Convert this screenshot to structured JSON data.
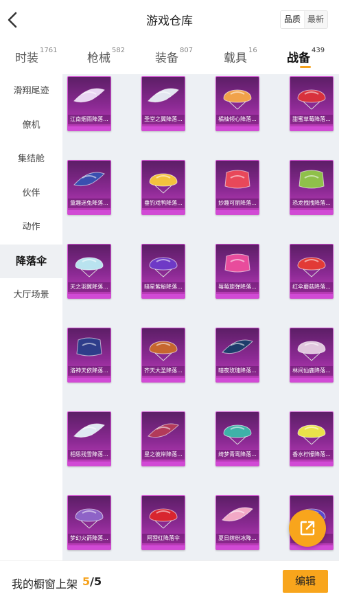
{
  "header": {
    "title": "游戏仓库",
    "sort_quality": "品质",
    "sort_latest": "最新"
  },
  "tabs": [
    {
      "label": "时装",
      "count": "1761",
      "active": false
    },
    {
      "label": "枪械",
      "count": "582",
      "active": false
    },
    {
      "label": "装备",
      "count": "807",
      "active": false
    },
    {
      "label": "载具",
      "count": "16",
      "active": false
    },
    {
      "label": "战备",
      "count": "439",
      "active": true
    }
  ],
  "sidebar": {
    "items": [
      {
        "label": "滑翔尾迹",
        "active": false
      },
      {
        "label": "僚机",
        "active": false
      },
      {
        "label": "集结舱",
        "active": false
      },
      {
        "label": "伙伴",
        "active": false
      },
      {
        "label": "动作",
        "active": false
      },
      {
        "label": "降落伞",
        "active": true
      },
      {
        "label": "大厅场景",
        "active": false
      }
    ]
  },
  "items": [
    {
      "name": "江南烟雨降落...",
      "color": "#e9d6f2",
      "shape": "wing"
    },
    {
      "name": "圣堂之翼降落...",
      "color": "#e3e6f0",
      "shape": "wing"
    },
    {
      "name": "橘柚倾心降落...",
      "color": "#f1a24a",
      "shape": "dome"
    },
    {
      "name": "甜蜜草莓降落...",
      "color": "#d8313d",
      "shape": "dome"
    },
    {
      "name": "童趣迷兔降落...",
      "color": "#3a4fb0",
      "shape": "wing"
    },
    {
      "name": "垂钓戏鸭降落...",
      "color": "#f3c23d",
      "shape": "dome"
    },
    {
      "name": "妙趣可丽降落...",
      "color": "#e8485a",
      "shape": "square"
    },
    {
      "name": "恐龙拽拽降落...",
      "color": "#8fc04a",
      "shape": "square"
    },
    {
      "name": "天之羽翼降落...",
      "color": "#b9e3ef",
      "shape": "dome"
    },
    {
      "name": "暗星紫秘降落...",
      "color": "#6e39c6",
      "shape": "dome"
    },
    {
      "name": "莓莓旋弹降落...",
      "color": "#e84c9c",
      "shape": "square"
    },
    {
      "name": "红伞蘑菇降落...",
      "color": "#e23a36",
      "shape": "dome"
    },
    {
      "name": "洛神天依降落...",
      "color": "#2e3d8a",
      "shape": "square"
    },
    {
      "name": "齐天大圣降落...",
      "color": "#c6662e",
      "shape": "dome"
    },
    {
      "name": "暗夜玫瑰降落...",
      "color": "#1d3c6b",
      "shape": "wing"
    },
    {
      "name": "林间仙鹿降落...",
      "color": "#e1c7de",
      "shape": "dome"
    },
    {
      "name": "相思残雪降落...",
      "color": "#dfe8f2",
      "shape": "wing"
    },
    {
      "name": "星之彼岸降落...",
      "color": "#b23a5a",
      "shape": "wing"
    },
    {
      "name": "绮梦青鸾降落...",
      "color": "#3fb2a8",
      "shape": "dome"
    },
    {
      "name": "香水柠檬降落...",
      "color": "#e9e24a",
      "shape": "dome"
    },
    {
      "name": "梦幻火箭降落...",
      "color": "#8e63c7",
      "shape": "dome"
    },
    {
      "name": "阿狸红降落伞",
      "color": "#d8252f",
      "shape": "dome"
    },
    {
      "name": "夏日缤纷冰降...",
      "color": "#f2a9c6",
      "shape": "wing"
    },
    {
      "name": "",
      "color": "#5c4bd1",
      "shape": "dome"
    }
  ],
  "footer": {
    "label": "我的橱窗上架",
    "current": "5",
    "separator": "/",
    "total": "5",
    "edit_label": "编辑"
  },
  "colors": {
    "accent": "#f8a51c",
    "card_purple": "#8c2a94"
  },
  "icons": [
    "back-arrow-icon",
    "share-icon"
  ]
}
